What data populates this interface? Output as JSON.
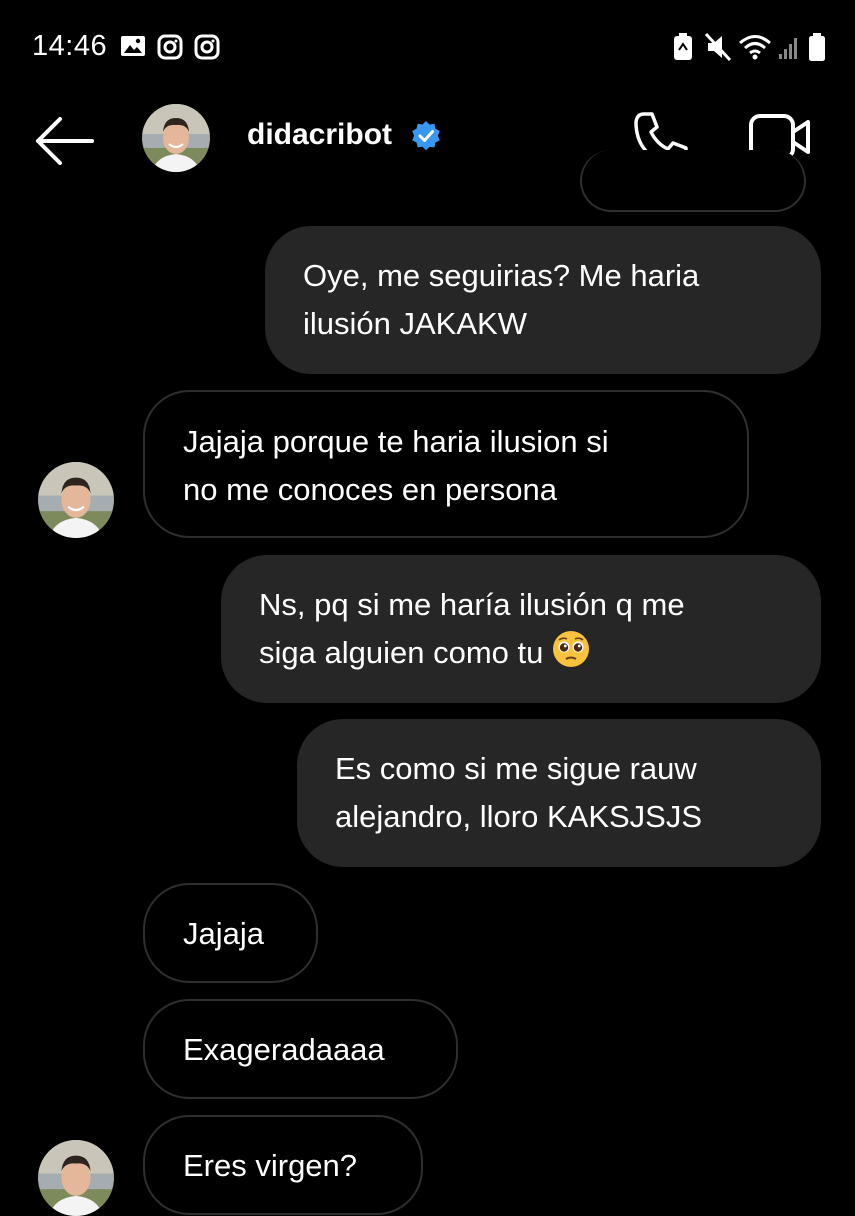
{
  "status_bar": {
    "time": "14:46"
  },
  "header": {
    "username": "didacribot",
    "verified": true,
    "icons": [
      "back-arrow-icon",
      "phone-icon",
      "video-camera-icon",
      "verified-badge-icon"
    ]
  },
  "messages": [
    {
      "direction": "outgoing",
      "lines": [
        "Oye, me seguirias? Me haria",
        "ilusión JAKAKW"
      ]
    },
    {
      "direction": "incoming",
      "lines": [
        "Jajaja porque te haria ilusion si",
        "no me conoces en persona"
      ]
    },
    {
      "direction": "outgoing",
      "lines": [
        "Ns, pq si me haría ilusión q me",
        "siga alguien como tu"
      ],
      "emoji": "pleading-face-emoji"
    },
    {
      "direction": "outgoing",
      "lines": [
        "Es como si me sigue rauw",
        "alejandro, lloro KAKSJSJS"
      ]
    },
    {
      "direction": "incoming",
      "lines": [
        "Jajaja"
      ]
    },
    {
      "direction": "incoming",
      "lines": [
        "Exageradaaaa"
      ]
    },
    {
      "direction": "incoming",
      "lines": [
        "Eres virgen?"
      ]
    }
  ],
  "colors": {
    "background": "#000000",
    "outgoing_bubble": "#262626",
    "incoming_border": "#2f2f2f",
    "verified_blue": "#3897f0"
  }
}
